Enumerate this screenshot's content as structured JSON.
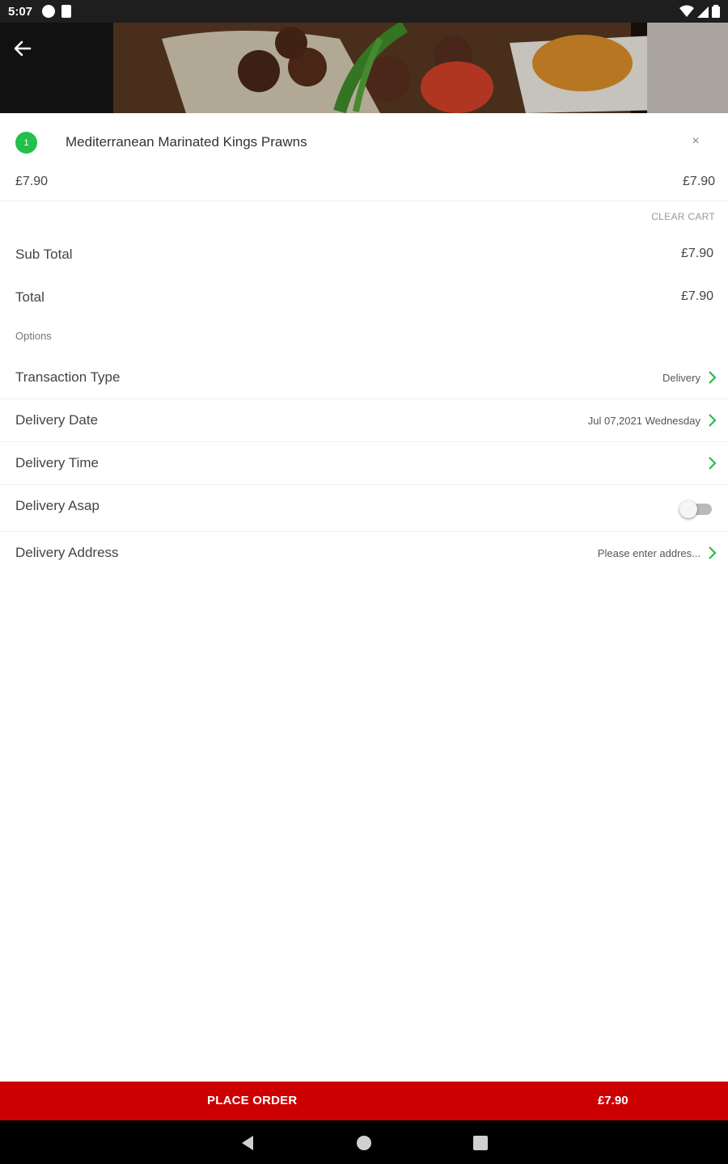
{
  "status_bar": {
    "time": "5:07",
    "left_icons": [
      "app-notification-icon",
      "sim-card-icon"
    ],
    "right_icons": [
      "wifi-icon",
      "signal-icon",
      "battery-icon"
    ]
  },
  "header": {
    "back_icon": "arrow-left-icon",
    "image": "food-photo"
  },
  "cart": {
    "items": [
      {
        "quantity": "1",
        "name": "Mediterranean Marinated Kings Prawns",
        "unit_price": "£7.90",
        "line_total": "£7.90"
      }
    ],
    "clear_label": "CLEAR CART"
  },
  "summary": {
    "subtotal_label": "Sub Total",
    "subtotal_value": "£7.90",
    "total_label": "Total",
    "total_value": "£7.90"
  },
  "options": {
    "heading": "Options",
    "transaction_type": {
      "label": "Transaction Type",
      "value": "Delivery"
    },
    "delivery_date": {
      "label": "Delivery Date",
      "value": "Jul 07,2021 Wednesday"
    },
    "delivery_time": {
      "label": "Delivery Time",
      "value": ""
    },
    "delivery_asap": {
      "label": "Delivery Asap",
      "enabled": false
    },
    "delivery_address": {
      "label": "Delivery Address",
      "value": "Please enter addres..."
    }
  },
  "place_order": {
    "label": "PLACE ORDER",
    "total": "£7.90"
  },
  "colors": {
    "accent_green": "#22c04a",
    "place_order_red": "#cc0000"
  },
  "nav": {
    "icons": [
      "back-triangle-icon",
      "home-circle-icon",
      "recents-square-icon"
    ]
  }
}
